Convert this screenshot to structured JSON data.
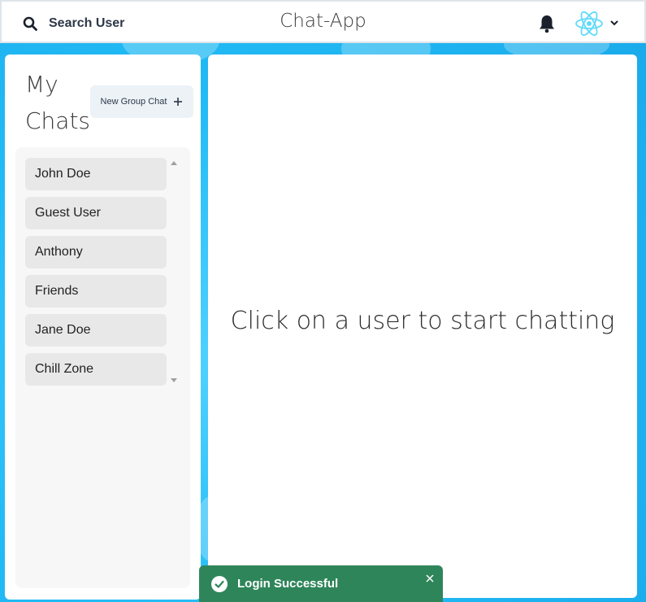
{
  "header": {
    "search_label": "Search User",
    "app_title": "Chat-App",
    "icons": {
      "search": "search-icon",
      "bell": "bell-icon",
      "avatar": "react-logo-avatar",
      "menu": "chevron-down-icon"
    }
  },
  "sidebar": {
    "title": "My Chats",
    "new_group_label": "New Group Chat",
    "chats": [
      {
        "name": "John Doe"
      },
      {
        "name": "Guest User"
      },
      {
        "name": "Anthony"
      },
      {
        "name": "Friends"
      },
      {
        "name": "Jane Doe"
      },
      {
        "name": "Chill Zone"
      }
    ]
  },
  "main": {
    "empty_message": "Click on a user to start chatting"
  },
  "toast": {
    "message": "Login Successful",
    "status": "success"
  },
  "colors": {
    "background": "#22bbf5",
    "toast": "#2f855a",
    "react_logo": "#61dafb"
  }
}
